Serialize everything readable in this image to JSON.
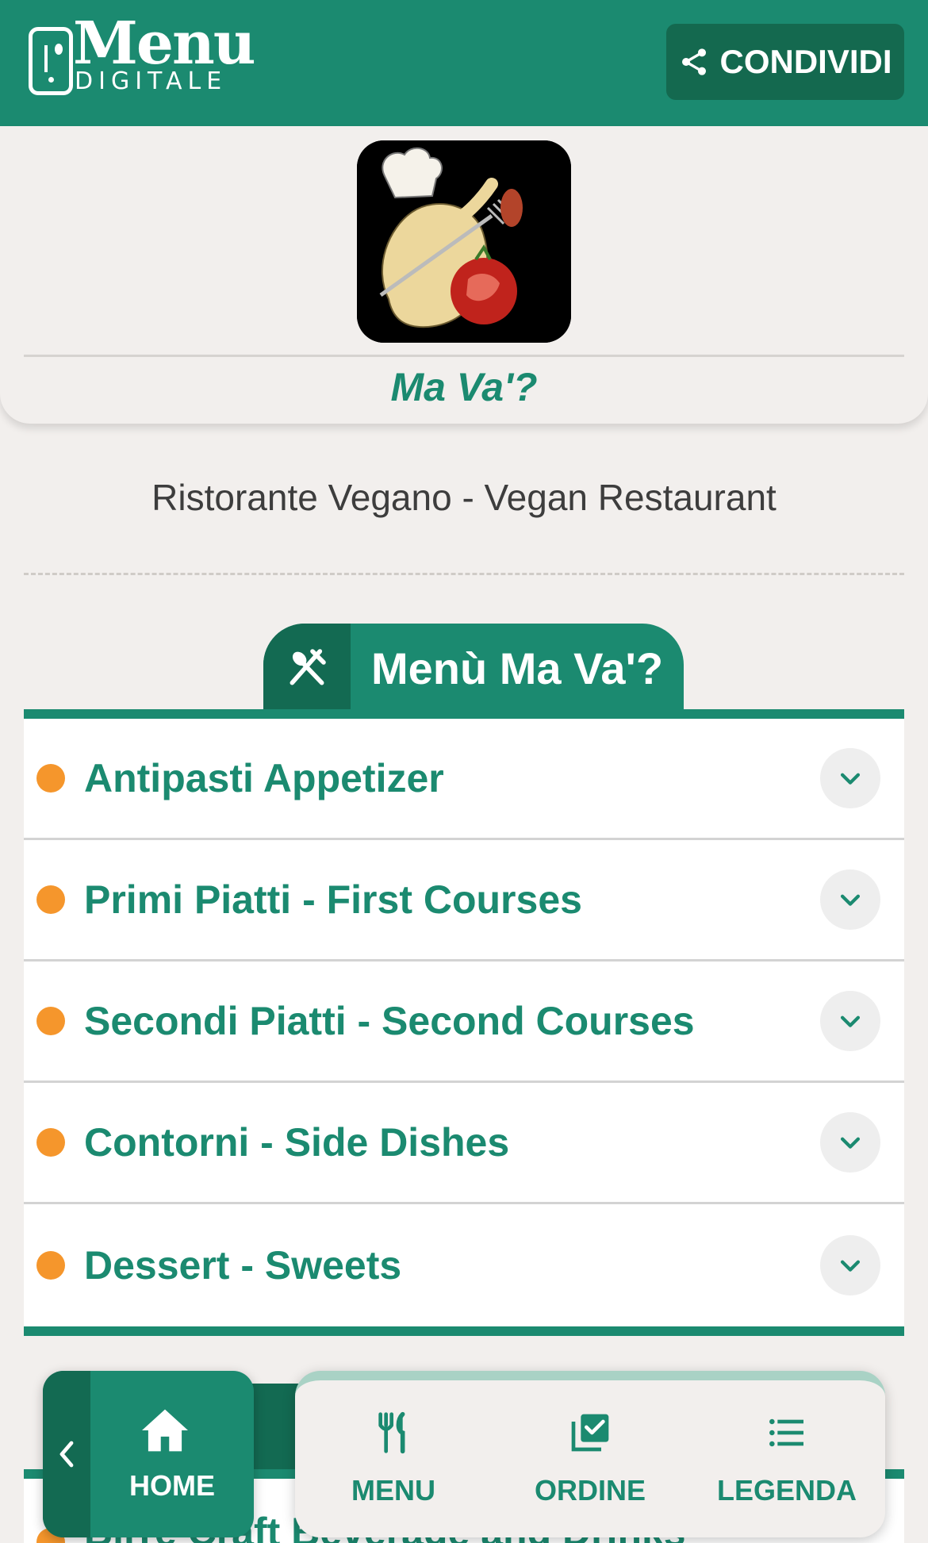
{
  "header": {
    "logo_text_main": "Menu",
    "logo_text_sub": "DIGITALE",
    "share_label": "CONDIVIDI"
  },
  "restaurant": {
    "name": "Ma Va'?",
    "tagline": "Ristorante Vegano - Vegan Restaurant"
  },
  "menu": {
    "title": "Menù Ma Va'?",
    "categories": [
      {
        "label": "Antipasti Appetizer"
      },
      {
        "label": "Primi Piatti - First Courses"
      },
      {
        "label": "Secondi Piatti - Second Courses"
      },
      {
        "label": "Contorni - Side Dishes"
      },
      {
        "label": "Dessert - Sweets"
      }
    ],
    "next_section_partial": "Birre Craft Beverage and Drinks"
  },
  "bottom_nav": {
    "home": "HOME",
    "menu": "MENU",
    "ordine": "ORDINE",
    "legenda": "LEGENDA"
  },
  "colors": {
    "primary": "#1b8a70",
    "primary_dark": "#136a52",
    "accent_dot": "#f5962c",
    "background": "#f2efed"
  }
}
